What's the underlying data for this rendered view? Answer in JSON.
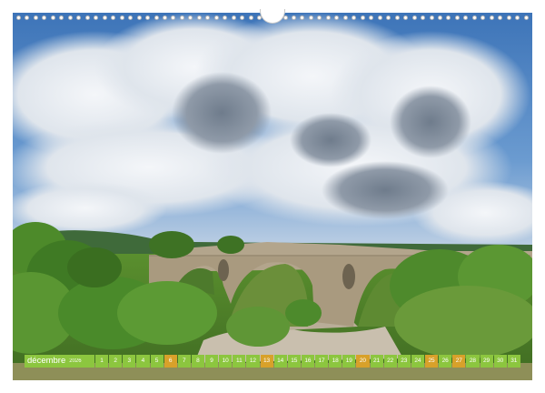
{
  "calendar": {
    "month": "décembre",
    "year": "2026",
    "days": [
      "1",
      "2",
      "3",
      "4",
      "5",
      "6",
      "7",
      "8",
      "9",
      "10",
      "11",
      "12",
      "13",
      "14",
      "15",
      "16",
      "17",
      "18",
      "19",
      "20",
      "21",
      "22",
      "23",
      "24",
      "25",
      "26",
      "27",
      "28",
      "29",
      "30",
      "31"
    ],
    "weekend_days": [
      "6",
      "13",
      "20",
      "25",
      "27"
    ],
    "colors": {
      "weekday": "#8cc63f",
      "weekend": "#d8a12a",
      "text": "#ffffff"
    }
  },
  "photo": {
    "subject": "stone-arch-bridge-landscape",
    "colors": {
      "sky": "#4f86c6",
      "cloud": "#e9edf2",
      "stone": "#b3a58c",
      "foliage": "#4e8a2c"
    }
  }
}
